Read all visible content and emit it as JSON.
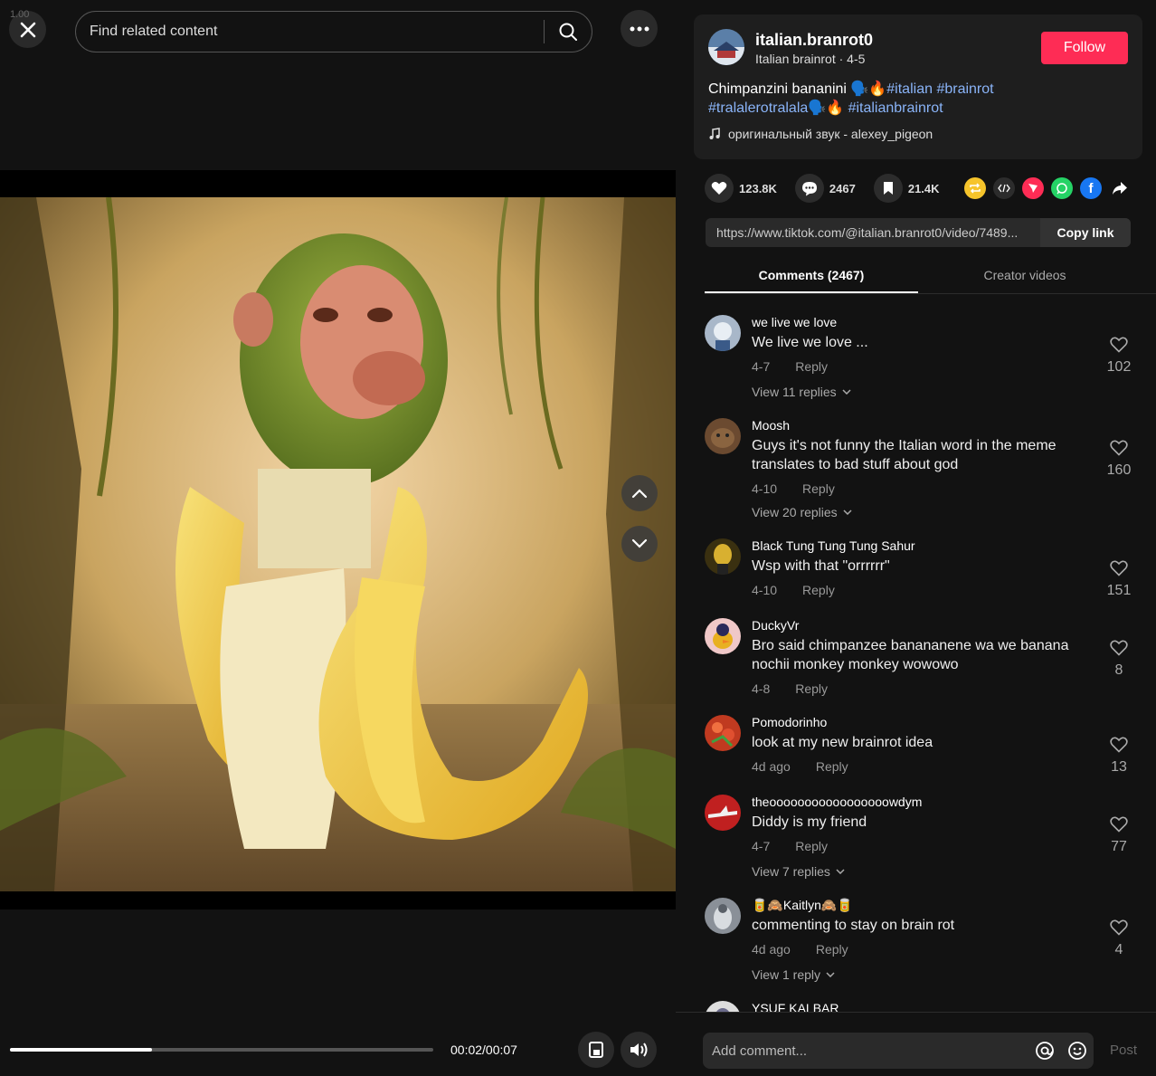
{
  "zoom_label": "1.00",
  "search": {
    "placeholder": "Find related content"
  },
  "video": {
    "time": "00:02/00:07",
    "progress": 0.335
  },
  "author": {
    "name": "italian.branrot0",
    "sub": "Italian brainrot · 4-5",
    "follow_label": "Follow",
    "desc_text": "Chimpanzini bananini 🗣️🔥",
    "tags": [
      "#italian",
      "#brainrot",
      "#tralalerotralala"
    ],
    "tag_suffix": "🗣️🔥",
    "tag_last": "#italianbrainrot",
    "music": "оригинальный звук - alexey_pigeon"
  },
  "actions": {
    "likes": "123.8K",
    "comments": "2467",
    "saves": "21.4K"
  },
  "link": {
    "url": "https://www.tiktok.com/@italian.branrot0/video/7489...",
    "copy_label": "Copy link"
  },
  "tabs": {
    "comments": "Comments (2467)",
    "creator": "Creator videos"
  },
  "comments": [
    {
      "user": "we live we love",
      "text": "We live we love ...",
      "date": "4-7",
      "reply": "Reply",
      "views": "View 11 replies",
      "likes": "102",
      "avatar_color": "#a8b7c9"
    },
    {
      "user": "Moosh",
      "text": "Guys it's not funny the Italian word in the meme translates to bad stuff about god",
      "date": "4-10",
      "reply": "Reply",
      "views": "View 20 replies",
      "likes": "160",
      "avatar_color": "#6b4a30"
    },
    {
      "user": "Black Tung Tung Tung Sahur",
      "text": "Wsp with that \"orrrrrr\"",
      "date": "4-10",
      "reply": "Reply",
      "views": "",
      "likes": "151",
      "avatar_color": "#3a3010"
    },
    {
      "user": "DuckyVr",
      "text": "Bro said chimpanzee banananene wa we banana nochii monkey monkey wowowo",
      "date": "4-8",
      "reply": "Reply",
      "views": "",
      "likes": "8",
      "avatar_color": "#f0c8c8"
    },
    {
      "user": "Pomodorinho",
      "text": "look at my new brainrot idea",
      "date": "4d ago",
      "reply": "Reply",
      "views": "",
      "likes": "13",
      "avatar_color": "#c03a20"
    },
    {
      "user": "theooooooooooooooooowdym",
      "text": "Diddy is my friend",
      "date": "4-7",
      "reply": "Reply",
      "views": "View 7 replies",
      "likes": "77",
      "avatar_color": "#c02020"
    },
    {
      "user": "🥫🙈Kaitlyn🙈🥫",
      "text": "commenting to stay on brain rot",
      "date": "4d ago",
      "reply": "Reply",
      "views": "View 1 reply",
      "likes": "4",
      "avatar_color": "#8a9098"
    },
    {
      "user": "YSUF KALBAR",
      "text": "",
      "date": "",
      "reply": "",
      "views": "",
      "likes": "",
      "avatar_color": "#ddd"
    }
  ],
  "comment_bar": {
    "placeholder": "Add comment...",
    "post_label": "Post"
  }
}
